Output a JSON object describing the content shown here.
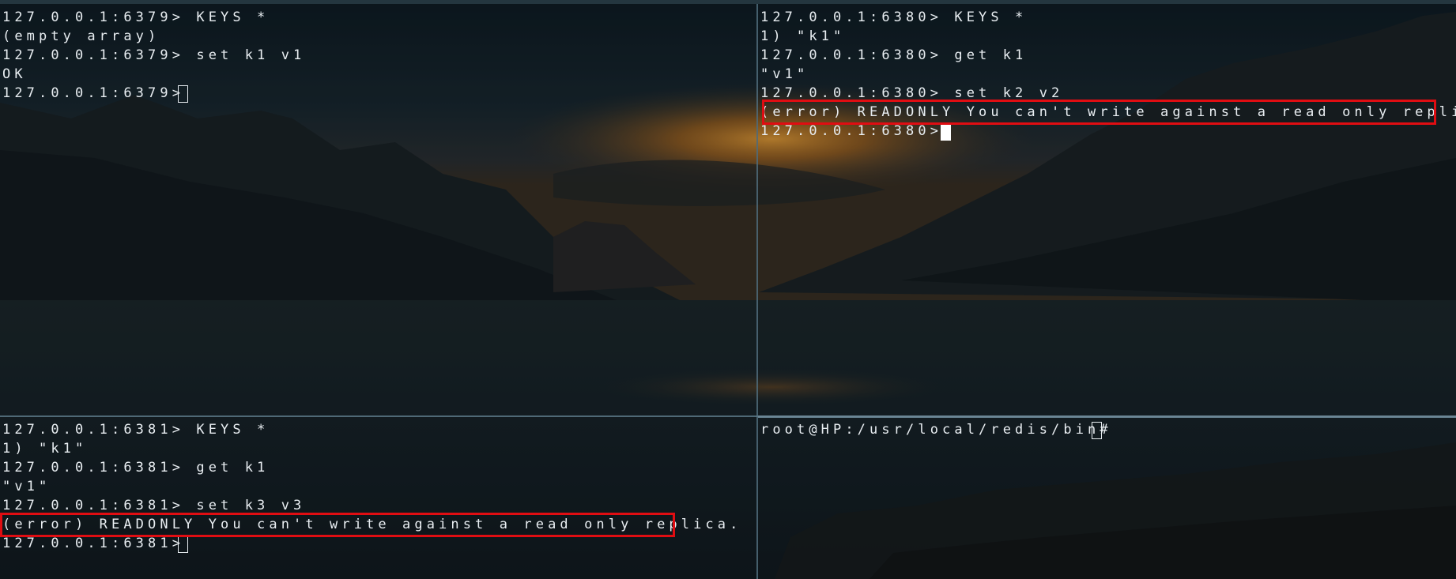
{
  "colors": {
    "terminal_text": "#e9eef2",
    "highlight_border": "#e00d12",
    "pane_divider": "#4f6b7a"
  },
  "panes": {
    "top_left": {
      "lines": [
        "127.0.0.1:6379> KEYS *",
        "(empty array)",
        "127.0.0.1:6379> set k1 v1",
        "OK",
        "127.0.0.1:6379> "
      ]
    },
    "top_right": {
      "lines": [
        "127.0.0.1:6380> KEYS *",
        "1) \"k1\"",
        "127.0.0.1:6380> get k1",
        "\"v1\"",
        "127.0.0.1:6380> set k2 v2",
        "(error) READONLY You can't write against a read only replica.",
        "127.0.0.1:6380> "
      ]
    },
    "bottom_left": {
      "lines": [
        "127.0.0.1:6381> KEYS *",
        "1) \"k1\"",
        "127.0.0.1:6381> get k1",
        "\"v1\"",
        "127.0.0.1:6381> set k3 v3",
        "(error) READONLY You can't write against a read only replica.",
        "127.0.0.1:6381> "
      ]
    },
    "bottom_right": {
      "lines": [
        "root@HP:/usr/local/redis/bin# "
      ]
    }
  }
}
